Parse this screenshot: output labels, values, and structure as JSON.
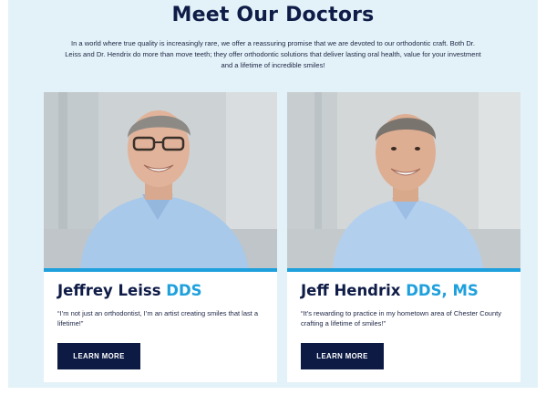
{
  "section": {
    "title": "Meet Our Doctors",
    "intro": "In a world where true quality is increasingly rare, we offer a reassuring promise that we are devoted to our orthodontic craft. Both Dr. Leiss and Dr. Hendrix do more than move teeth; they offer orthodontic solutions that deliver lasting oral health, value for your investment and a lifetime of incredible smiles!"
  },
  "colors": {
    "background": "#e3f2f8",
    "heading": "#0f1c47",
    "accent": "#1ea0dd",
    "button": "#0c1a44"
  },
  "doctors": [
    {
      "name": "Jeffrey Leiss",
      "credentials": "DDS",
      "quote": "“I’m not just an orthodontist, I’m an artist creating smiles that last a lifetime!”",
      "button_label": "LEARN MORE",
      "photo_icon": "portrait-photo"
    },
    {
      "name": "Jeff Hendrix",
      "credentials": "DDS, MS",
      "quote": "“It’s rewarding to practice in my hometown area of Chester County crafting a lifetime of smiles!”",
      "button_label": "LEARN MORE",
      "photo_icon": "portrait-photo"
    }
  ]
}
